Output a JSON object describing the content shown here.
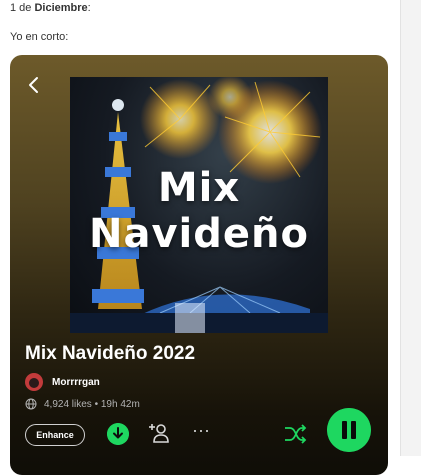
{
  "message": {
    "date_prefix": "1 de ",
    "date_month": "Diciembre",
    "date_suffix": ":",
    "caption": "Yo en corto:"
  },
  "cover": {
    "line1": "Mix",
    "line2": "Navideño"
  },
  "playlist": {
    "title": "Mix Navideño 2022",
    "owner": "Morrrrgan",
    "meta": "4,924 likes • 19h 42m"
  },
  "controls": {
    "enhance_label": "Enhance",
    "more_glyph": "···"
  },
  "colors": {
    "accent_green": "#1ed760",
    "card_top": "#6d5a2a",
    "card_bottom": "#0f0d07"
  },
  "icons": [
    "back-arrow-icon",
    "globe-icon",
    "download-icon",
    "add-user-icon",
    "more-icon",
    "shuffle-icon",
    "pause-icon"
  ]
}
